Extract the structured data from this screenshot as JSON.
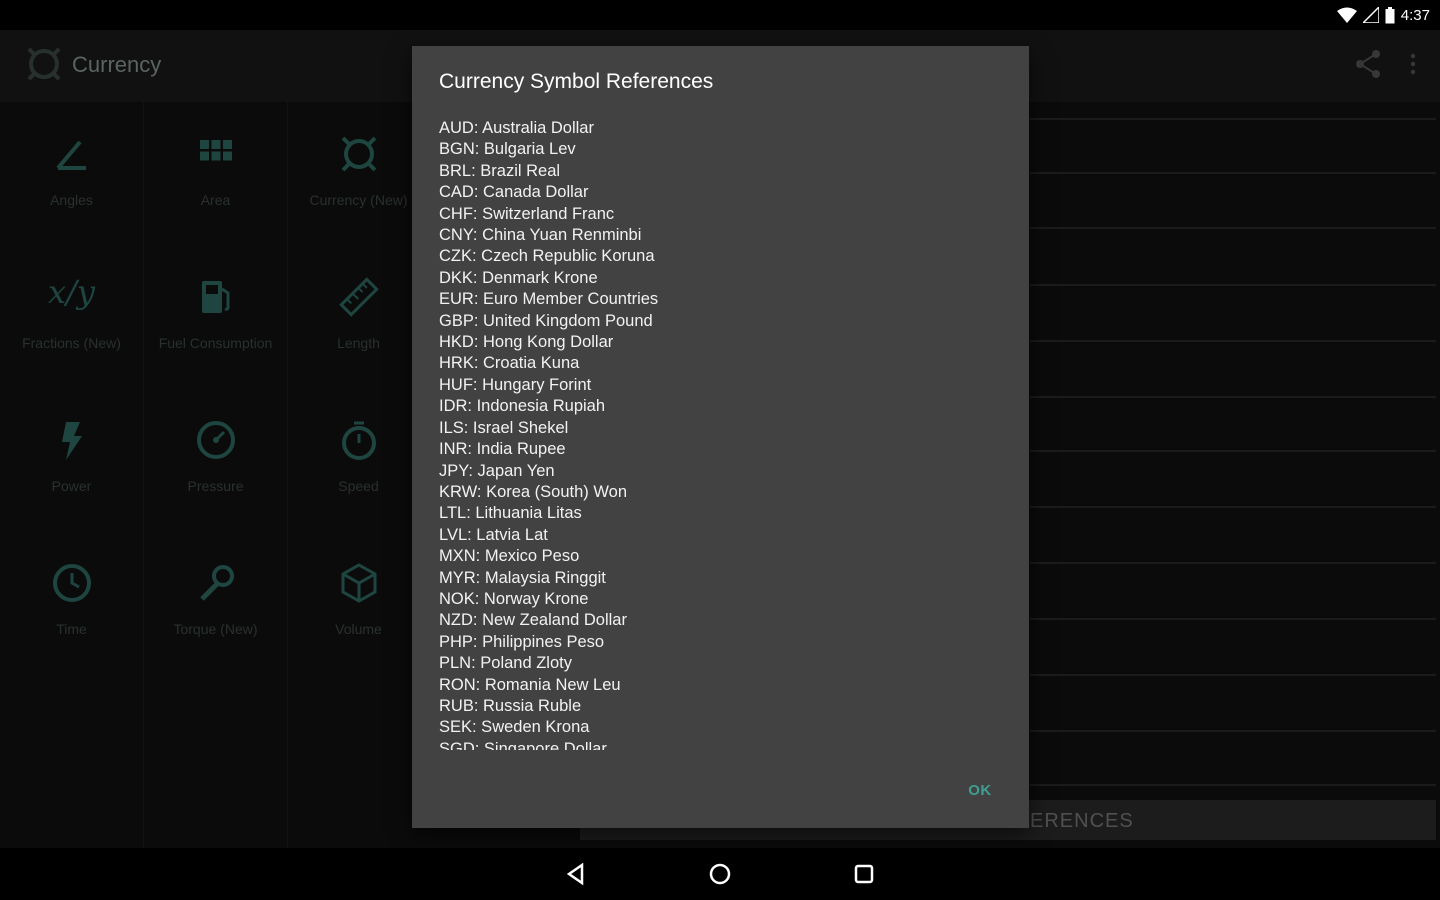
{
  "status": {
    "time": "4:37"
  },
  "app": {
    "title": "Currency"
  },
  "categories": [
    {
      "label": "Angles",
      "icon": "angle-icon"
    },
    {
      "label": "Area",
      "icon": "grid-icon"
    },
    {
      "label": "Currency (New)",
      "icon": "currency-icon"
    },
    {
      "label": "Fractions (New)",
      "icon": "fraction-icon"
    },
    {
      "label": "Fuel Consumption",
      "icon": "fuel-icon"
    },
    {
      "label": "Length",
      "icon": "ruler-icon"
    },
    {
      "label": "Power",
      "icon": "lightning-icon"
    },
    {
      "label": "Pressure",
      "icon": "gauge-icon"
    },
    {
      "label": "Speed",
      "icon": "stopwatch-icon"
    },
    {
      "label": "Time",
      "icon": "clock-icon"
    },
    {
      "label": "Torque (New)",
      "icon": "wrench-icon"
    },
    {
      "label": "Volume",
      "icon": "cube-icon"
    }
  ],
  "fraction_glyph": "x/y",
  "panel": {
    "bottom_label": "ERENCES"
  },
  "dialog": {
    "title": "Currency Symbol References",
    "items": [
      "AUD: Australia Dollar",
      "BGN: Bulgaria Lev",
      "BRL: Brazil Real",
      "CAD: Canada Dollar",
      "CHF: Switzerland Franc",
      "CNY: China Yuan Renminbi",
      "CZK: Czech Republic Koruna",
      "DKK: Denmark Krone",
      "EUR: Euro Member Countries",
      "GBP: United Kingdom Pound",
      "HKD: Hong Kong Dollar",
      "HRK: Croatia Kuna",
      "HUF: Hungary Forint",
      "IDR: Indonesia Rupiah",
      "ILS: Israel Shekel",
      "INR: India Rupee",
      "JPY: Japan Yen",
      "KRW: Korea (South) Won",
      "LTL: Lithuania Litas",
      "LVL: Latvia Lat",
      "MXN: Mexico Peso",
      "MYR: Malaysia Ringgit",
      "NOK: Norway Krone",
      "NZD: New Zealand Dollar",
      "PHP: Philippines Peso",
      "PLN: Poland Zloty",
      "RON: Romania New Leu",
      "RUB: Russia Ruble",
      "SEK: Sweden Krona",
      "SGD: Singapore Dollar"
    ],
    "ok_label": "OK"
  },
  "colors": {
    "accent": "#3f9f90",
    "icon": "#2f6b63",
    "dialog_bg": "#424242"
  }
}
